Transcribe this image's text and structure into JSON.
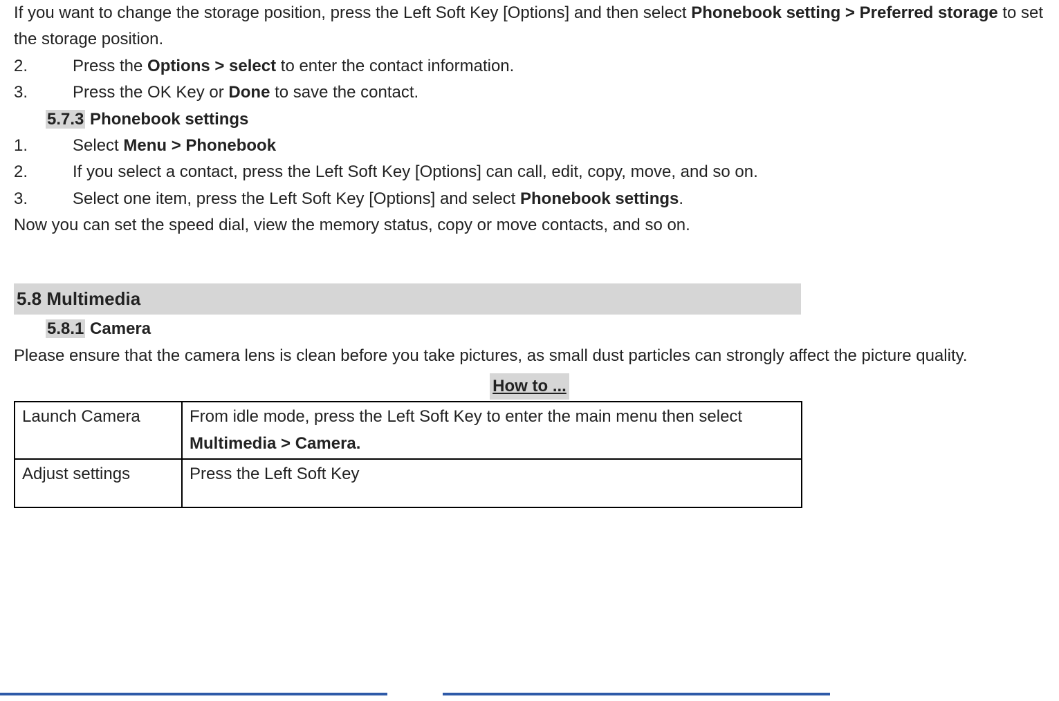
{
  "intro": {
    "line1_pre": "If you want to change the storage position, press the Left Soft Key [Options] and then select ",
    "line1_bold": "Phonebook setting > Preferred storage",
    "line1_post": " to set the storage position."
  },
  "steps_a": [
    {
      "n": "2.",
      "pre": "Press the ",
      "bold": "Options > select",
      "post": " to enter the contact information."
    },
    {
      "n": "3.",
      "pre": "Press the OK Key or ",
      "bold": "Done",
      "post": " to save the contact."
    }
  ],
  "sec573": {
    "num": "5.7.3",
    "title": " Phonebook settings"
  },
  "steps_b": {
    "s1": {
      "n": "1.",
      "pre": "Select ",
      "bold": "Menu > Phonebook"
    },
    "s2": {
      "n": "2.",
      "text": "If you select a contact, press the Left Soft Key [Options] can call, edit, copy, move, and so on."
    },
    "s3": {
      "n": "3.",
      "pre": "Select one item, press the Left Soft Key [Options] and select ",
      "bold": "Phonebook settings",
      "post": "."
    }
  },
  "after_b": "Now you can set the speed dial, view the memory status, copy or move contacts, and so on.",
  "sec58": {
    "title": "5.8 Multimedia"
  },
  "sec581": {
    "num": "5.8.1",
    "title": " Camera"
  },
  "camera_intro": "Please ensure that the camera lens is clean before you take pictures, as small dust particles can strongly affect the picture quality.",
  "howto_label": "How to ...",
  "table": {
    "r1": {
      "c1": "Launch Camera",
      "c2_pre": "From idle mode, press the Left Soft Key to enter the main menu then select ",
      "c2_bold": "Multimedia > Camera."
    },
    "r2": {
      "c1": "Adjust settings",
      "c2": "Press the Left Soft Key"
    }
  }
}
